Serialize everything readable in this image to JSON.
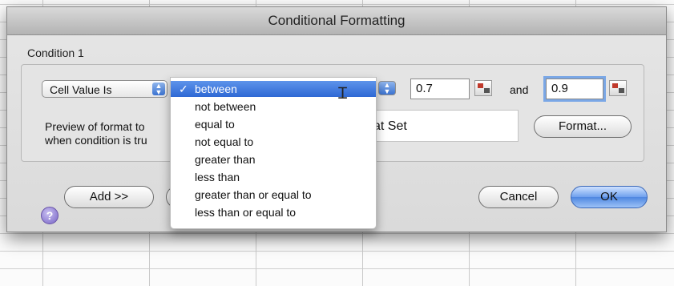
{
  "dialog": {
    "title": "Conditional Formatting",
    "condition_label": "Condition 1",
    "condition_type": "Cell Value Is",
    "value1": "0.7",
    "and_label": "and",
    "value2": "0.9",
    "preview_label_line1": "Preview of format to",
    "preview_label_line2": "when condition is tru",
    "preview_text": "at Set",
    "format_button": "Format...",
    "add_button": "Add >>",
    "cancel_button": "Cancel",
    "ok_button": "OK",
    "help_glyph": "?"
  },
  "operator_menu": {
    "selected": "between",
    "check_glyph": "✓",
    "items": [
      "between",
      "not between",
      "equal to",
      "not equal to",
      "greater than",
      "less than",
      "greater than or equal to",
      "less than or equal to"
    ]
  },
  "icons": {
    "popup_arrows": "▲▼",
    "ibeam_cursor": "⌶",
    "cell_ref": "cell-reference-icon"
  },
  "colors": {
    "selection": "#2e68d4",
    "focus_ring": "#7aa7e6"
  }
}
